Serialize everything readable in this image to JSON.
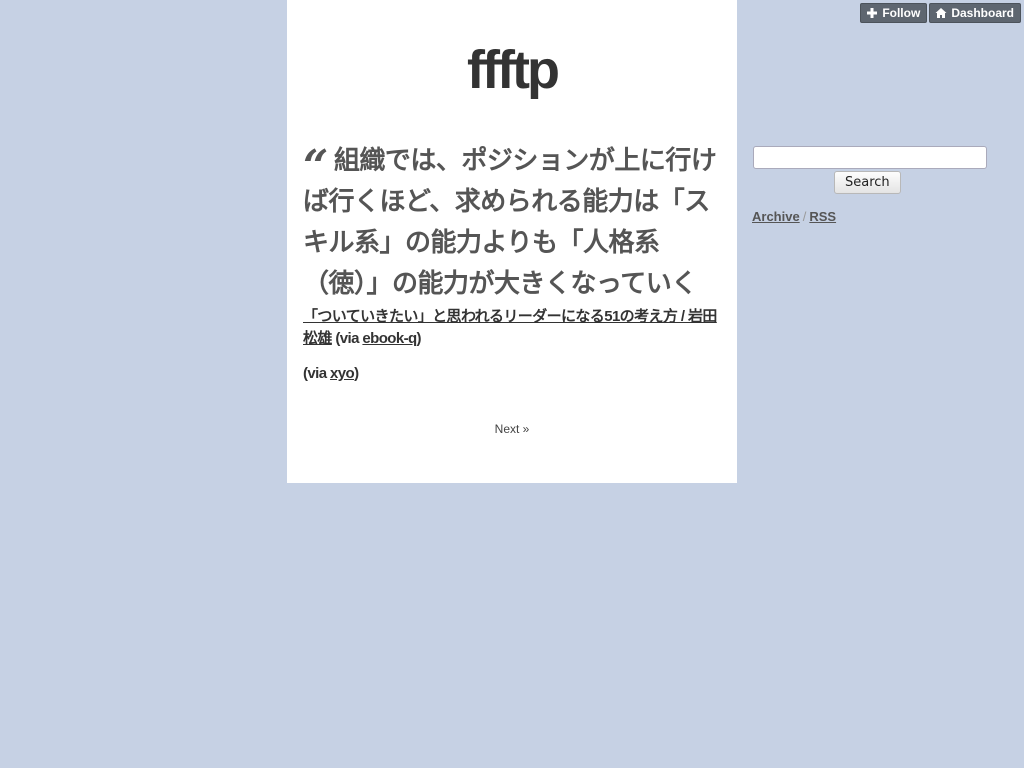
{
  "header": {
    "follow_label": "Follow",
    "dashboard_label": "Dashboard"
  },
  "blog": {
    "title": "ffftp"
  },
  "post": {
    "quote_mark": "“",
    "quote_text": "組織では、ポジションが上に行けば行くほど、求められる能力は「スキル系」の能力よりも「人格系（徳）」の能力が大きくなっていく",
    "source_link": "「ついていきたい」と思われるリーダーになる51の考え方 / 岩田松雄",
    "source_via_prefix": " (via ",
    "source_via_link": "ebook-q",
    "source_via_suffix": ")",
    "via_prefix": "(via ",
    "via_link": "xyo",
    "via_suffix": ")"
  },
  "pagination": {
    "next_label": "Next »"
  },
  "sidebar": {
    "search_value": "",
    "search_button_label": "Search",
    "archive_label": "Archive",
    "separator": "/",
    "rss_label": "RSS"
  },
  "colors": {
    "background": "#c6d1e4",
    "content_bg": "#ffffff",
    "button_bg": "#5e6670"
  },
  "icons": {
    "follow": "plus-icon",
    "dashboard": "home-icon"
  }
}
